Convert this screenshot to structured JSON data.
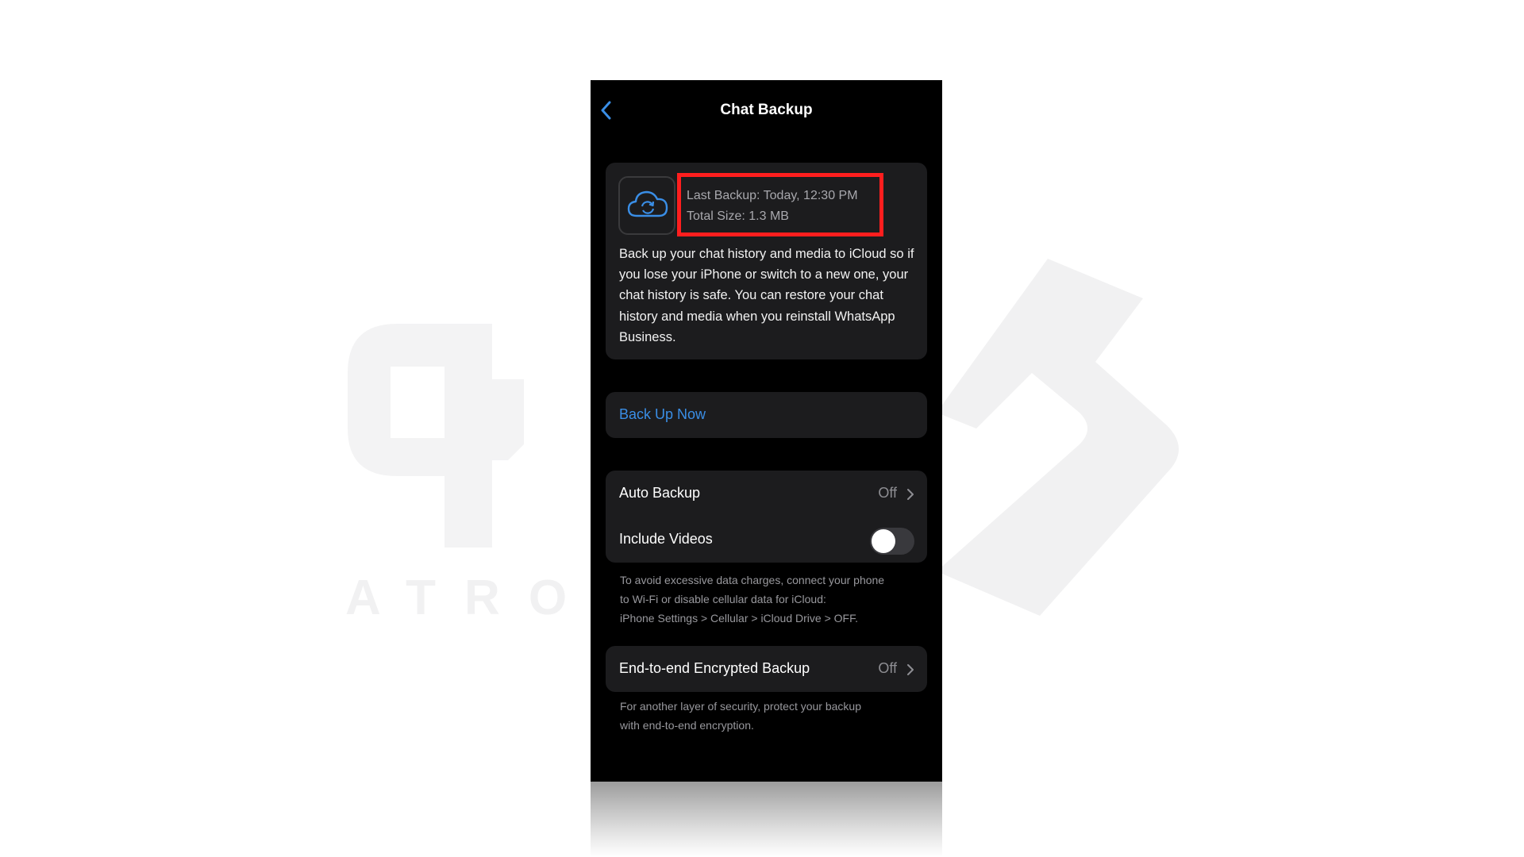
{
  "watermark": {
    "text": "ATRO A"
  },
  "header": {
    "title": "Chat Backup",
    "back_icon": "chevron-left-icon"
  },
  "backup_info": {
    "icon": "cloud-sync-icon",
    "last_backup": "Last Backup: Today, 12:30 PM",
    "total_size": "Total Size: 1.3 MB",
    "description": "Back up your chat history and media to iCloud so if you lose your iPhone or switch to a new one, your chat history is safe. You can restore your chat history and media when you reinstall WhatsApp Business."
  },
  "actions": {
    "back_up_now": "Back Up Now"
  },
  "settings": {
    "auto_backup": {
      "label": "Auto Backup",
      "value": "Off"
    },
    "include_videos": {
      "label": "Include Videos",
      "enabled": false
    },
    "data_charges_note_1": "To avoid excessive data charges, connect your phone",
    "data_charges_note_2": "to Wi-Fi or disable cellular data for iCloud:",
    "data_charges_note_3": "iPhone Settings > Cellular > iCloud Drive > OFF.",
    "e2e_backup": {
      "label": "End-to-end Encrypted Backup",
      "value": "Off"
    },
    "e2e_note_1": "For another layer of security, protect your backup",
    "e2e_note_2": "with end-to-end encryption."
  },
  "colors": {
    "accent_blue": "#3a8ee6",
    "highlight_red": "#ff1e1e",
    "card_bg": "#1c1c1e",
    "screen_bg": "#000000"
  }
}
